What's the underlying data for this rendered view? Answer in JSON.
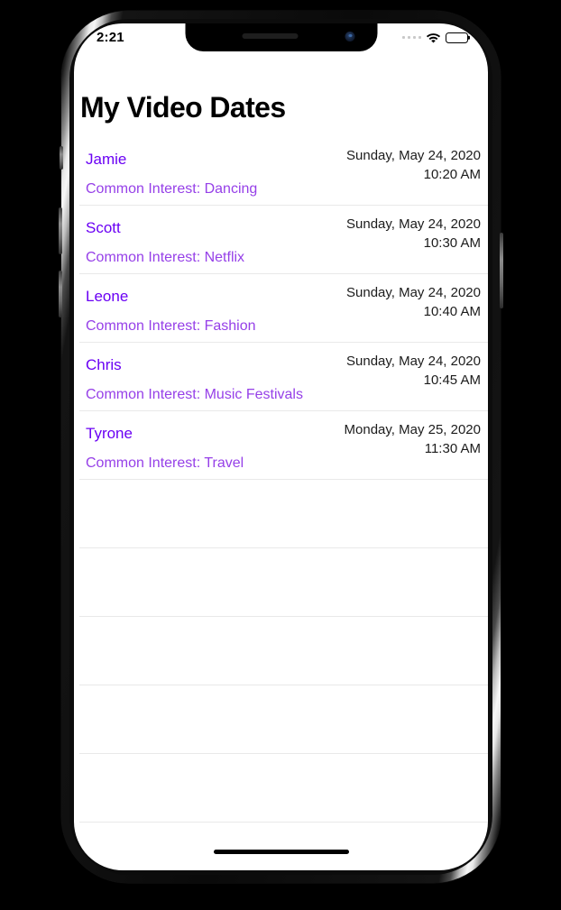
{
  "status_bar": {
    "time": "2:21",
    "signal_icon": "signal-dots-icon",
    "wifi_icon": "wifi-icon",
    "battery_icon": "battery-icon"
  },
  "app": {
    "title": "My Video Dates"
  },
  "list": {
    "rows": [
      {
        "name": "Jamie",
        "date": "Sunday, May 24, 2020",
        "time": "10:20 AM",
        "date_time": "Sunday, May 24, 2020\n10:20 AM",
        "interest": "Common Interest: Dancing"
      },
      {
        "name": "Scott",
        "date": "Sunday, May 24, 2020",
        "time": "10:30 AM",
        "date_time": "Sunday, May 24, 2020\n10:30 AM",
        "interest": "Common Interest: Netflix"
      },
      {
        "name": "Leone",
        "date": "Sunday, May 24, 2020",
        "time": "10:40 AM",
        "date_time": "Sunday, May 24, 2020\n10:40 AM",
        "interest": "Common Interest: Fashion"
      },
      {
        "name": "Chris",
        "date": "Sunday, May 24, 2020",
        "time": "10:45 AM",
        "date_time": "Sunday, May 24, 2020\n10:45 AM",
        "interest": "Common Interest: Music Festivals"
      },
      {
        "name": "Tyrone",
        "date": "Monday, May 25, 2020",
        "time": "11:30 AM",
        "date_time": "Monday, May 25, 2020\n11:30 AM",
        "interest": "Common Interest: Travel"
      },
      {
        "name": "",
        "date": "",
        "time": "",
        "date_time": "",
        "interest": ""
      },
      {
        "name": "",
        "date": "",
        "time": "",
        "date_time": "",
        "interest": ""
      },
      {
        "name": "",
        "date": "",
        "time": "",
        "date_time": "",
        "interest": ""
      },
      {
        "name": "",
        "date": "",
        "time": "",
        "date_time": "",
        "interest": ""
      },
      {
        "name": "",
        "date": "",
        "time": "",
        "date_time": "",
        "interest": ""
      }
    ]
  },
  "colors": {
    "name_purple": "#6a00f4",
    "interest_purple": "#9640e8",
    "title_black": "#000000",
    "date_black": "#1c1c1c",
    "separator": "#e9e9e9",
    "screen_background": "#ffffff"
  }
}
